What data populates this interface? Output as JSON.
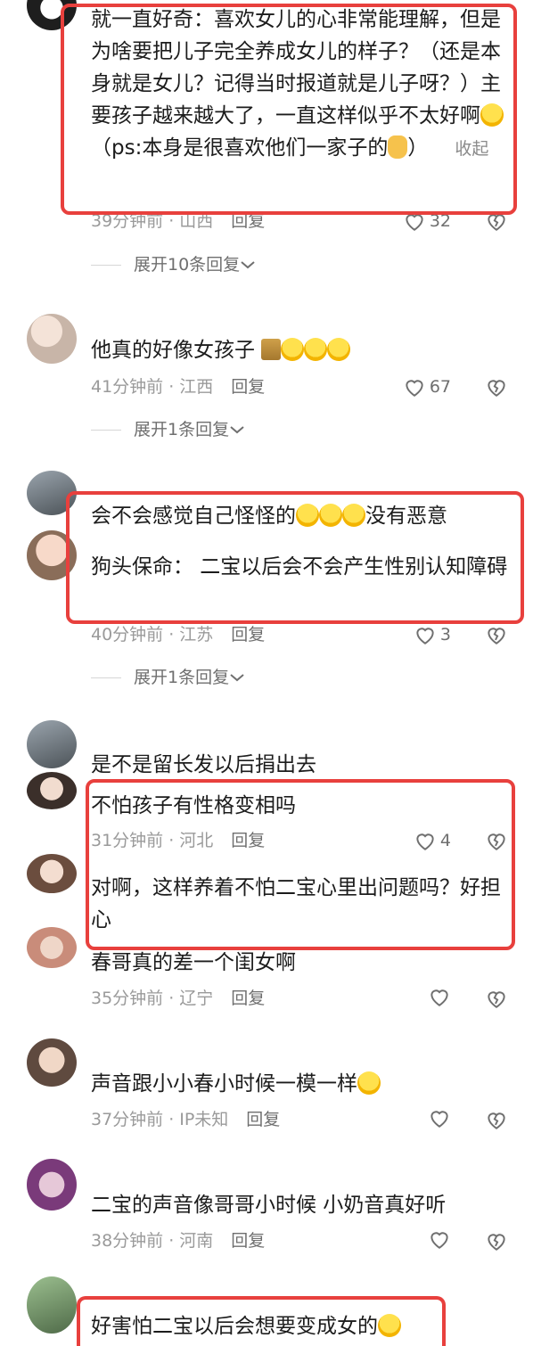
{
  "comments": [
    {
      "text": "就一直好奇：喜欢女儿的心非常能理解，但是为啥要把儿子完全养成女儿的样子？（还是本身就是女儿？记得当时报道就是儿子呀？）主要孩子越来越大了，一直这样似乎不太好啊",
      "text_tail": "（ps:本身是很喜欢他们一家子的",
      "text_end": "）",
      "collapse": "收起",
      "time": "39分钟前",
      "location": "山西",
      "reply": "回复",
      "likes": "32",
      "expand": "展开10条回复"
    },
    {
      "text": "他真的好像女孩子",
      "time": "41分钟前",
      "location": "江西",
      "reply": "回复",
      "likes": "67",
      "expand": "展开1条回复"
    },
    {
      "text": "会不会感觉自己怪怪的",
      "text_end": "没有恶意",
      "text2": "狗头保命：  二宝以后会不会产生性别认知障碍",
      "time": "40分钟前",
      "location": "江苏",
      "reply": "回复",
      "likes": "3",
      "expand": "展开1条回复"
    },
    {
      "text": "是不是留长发以后捐出去",
      "text2": "不怕孩子有性格变相吗",
      "time": "31分钟前",
      "location": "河北",
      "reply": "回复",
      "likes": "4"
    },
    {
      "text": "对啊，这样养着不怕二宝心里出问题吗？好担心"
    },
    {
      "text": "春哥真的差一个闺女啊",
      "time": "35分钟前",
      "location": "辽宁",
      "reply": "回复"
    },
    {
      "text": "声音跟小小春小时候一模一样",
      "time": "37分钟前",
      "location": "IP未知",
      "reply": "回复"
    },
    {
      "text": "二宝的声音像哥哥小时候 小奶音真好听",
      "time": "38分钟前",
      "location": "河南",
      "reply": "回复"
    },
    {
      "text": "好害怕二宝以后会想要变成女的"
    }
  ],
  "meta_separator": "·",
  "colors": {
    "highlight": "#e8403d",
    "meta": "#9a9a9a"
  },
  "icons": {
    "like": "heart-icon",
    "dislike": "broken-heart-icon",
    "chevron": "chevron-down-icon"
  }
}
